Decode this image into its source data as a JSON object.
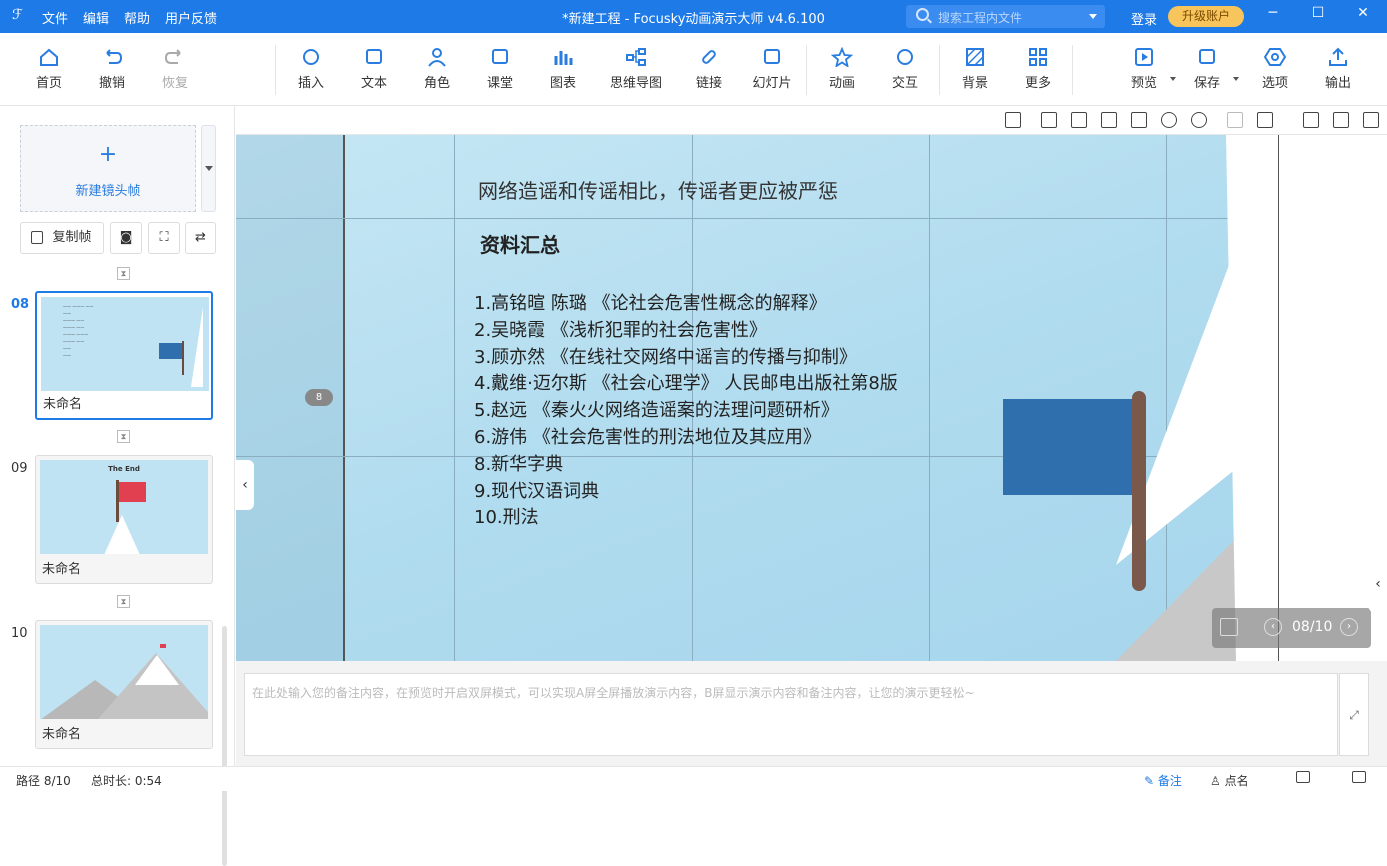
{
  "app": {
    "logo": "ℱ",
    "menu": [
      "文件",
      "编辑",
      "帮助",
      "用户反馈"
    ],
    "title": "*新建工程 - Focusky动画演示大师  v4.6.100",
    "search_placeholder": "搜索工程内文件",
    "login": "登录",
    "upgrade": "升级账户",
    "accent": "#1e7ae6"
  },
  "ribbon": {
    "left": [
      {
        "label": "首页",
        "icon": "home-icon"
      },
      {
        "label": "撤销",
        "icon": "undo-icon"
      },
      {
        "label": "恢复",
        "icon": "redo-icon"
      }
    ],
    "middle": [
      {
        "label": "插入",
        "icon": "plus-circle-icon"
      },
      {
        "label": "文本",
        "icon": "text-icon"
      },
      {
        "label": "角色",
        "icon": "person-icon"
      },
      {
        "label": "课堂",
        "icon": "classroom-icon"
      },
      {
        "label": "图表",
        "icon": "chart-icon"
      },
      {
        "label": "思维导图",
        "icon": "mindmap-icon"
      },
      {
        "label": "链接",
        "icon": "link-icon"
      },
      {
        "label": "幻灯片",
        "icon": "slide-icon"
      }
    ],
    "anim": [
      {
        "label": "动画",
        "icon": "star-icon"
      },
      {
        "label": "交互",
        "icon": "hand-icon"
      }
    ],
    "bg": [
      {
        "label": "背景",
        "icon": "background-icon"
      },
      {
        "label": "更多",
        "icon": "more-grid-icon"
      }
    ],
    "right": [
      {
        "label": "预览",
        "icon": "play-icon"
      },
      {
        "label": "保存",
        "icon": "save-icon"
      },
      {
        "label": "选项",
        "icon": "settings-hex-icon"
      },
      {
        "label": "输出",
        "icon": "export-icon"
      }
    ]
  },
  "sidebar": {
    "new_frame": "新建镜头帧",
    "copy_frame": "复制帧",
    "frames": [
      {
        "num": "08",
        "name": "未命名",
        "selected": true
      },
      {
        "num": "09",
        "name": "未命名",
        "selected": false,
        "thumb_title": "The End"
      },
      {
        "num": "10",
        "name": "未命名",
        "selected": false
      }
    ]
  },
  "slide": {
    "title": "网络造谣和传谣相比，传谣者更应被严惩",
    "heading": "资料汇总",
    "items": [
      "1.高铭暄 陈璐 《论社会危害性概念的解释》",
      "2.吴晓霞 《浅析犯罪的社会危害性》",
      "3.顾亦然 《在线社交网络中谣言的传播与抑制》",
      "4.戴维·迈尔斯 《社会心理学》 人民邮电出版社第8版",
      "5.赵远 《秦火火网络造谣案的法理问题研析》",
      "6.游伟 《社会危害性的刑法地位及其应用》",
      "8.新华字典",
      "9.现代汉语词典",
      "10.刑法"
    ],
    "frame_badge": "8",
    "flag_color": "#2f6fae",
    "page_indicator": "08/10"
  },
  "notes": {
    "placeholder": "在此处输入您的备注内容，在预览时开启双屏模式，可以实现A屏全屏播放演示内容，B屏显示演示内容和备注内容，让您的演示更轻松~"
  },
  "status": {
    "path": "路径 8/10",
    "duration": "总时长: 0:54",
    "notes_tab": "备注",
    "roll_call": "点名"
  }
}
